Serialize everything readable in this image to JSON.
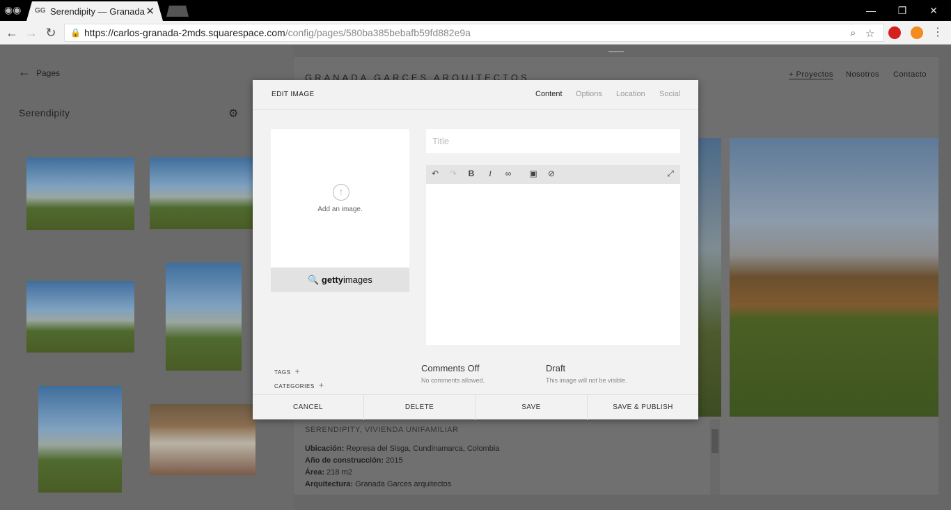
{
  "browser": {
    "tab_title": "Serendipity — Granada G",
    "tab_favicon": "GG",
    "url_host": "https://carlos-granada-2mds.squarespace.com",
    "url_path": "/config/pages/580ba385bebafb59fd882e9a"
  },
  "left_panel": {
    "back_label": "Pages",
    "page_name": "Serendipity"
  },
  "site": {
    "logo": "GRANADA GARCES ARQUITECTOS",
    "nav": [
      "+ Proyectos",
      "Nosotros",
      "Contacto"
    ],
    "project_heading": "SERENDIPITY, VIVIENDA UNIFAMILIAR",
    "details": [
      {
        "label": "Ubicación:",
        "value": " Represa del Sisga, Cundinamarca, Colombia"
      },
      {
        "label": "Año de construcción:",
        "value": " 2015"
      },
      {
        "label": "Área:",
        "value": " 218 m2"
      },
      {
        "label": "Arquitectura:",
        "value": " Granada Garces arquitectos"
      }
    ]
  },
  "modal": {
    "title": "EDIT IMAGE",
    "tabs": [
      "Content",
      "Options",
      "Location",
      "Social"
    ],
    "add_image": "Add an image.",
    "getty_bold": "getty",
    "getty_light": "images",
    "title_placeholder": "Title",
    "tags_label": "TAGS",
    "categories_label": "CATEGORIES",
    "comments_head": "Comments Off",
    "comments_sub": "No comments allowed.",
    "draft_head": "Draft",
    "draft_sub": "This image will not be visible.",
    "buttons": [
      "CANCEL",
      "DELETE",
      "SAVE",
      "SAVE & PUBLISH"
    ]
  }
}
